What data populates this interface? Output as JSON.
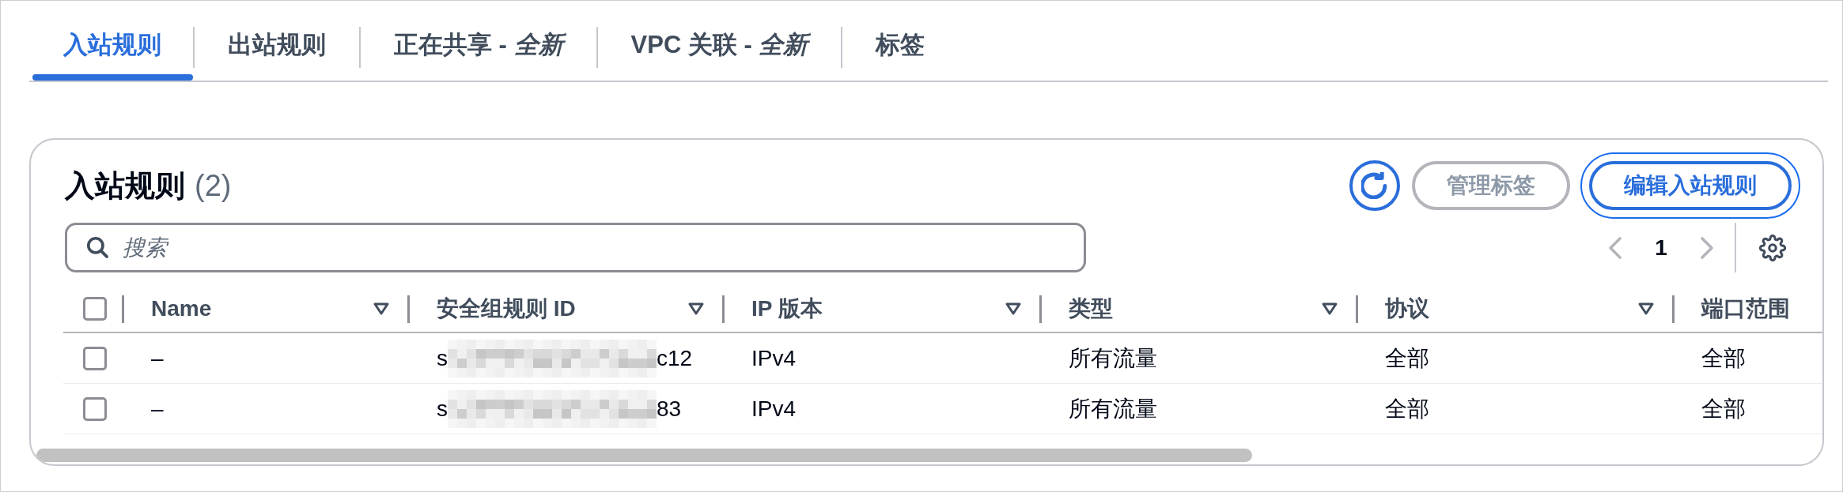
{
  "tabs": [
    {
      "label": "入站规则",
      "selected": true
    },
    {
      "label": "出站规则",
      "selected": false
    },
    {
      "label": "正在共享 - *全新*",
      "selected": false
    },
    {
      "label": "VPC 关联 - *全新*",
      "selected": false
    },
    {
      "label": "标签",
      "selected": false
    }
  ],
  "panel": {
    "title": "入站规则",
    "count": "(2)",
    "actions": [
      {
        "kind": "refresh",
        "disabled": false,
        "focused": false
      },
      {
        "kind": "text",
        "label": "管理标签",
        "disabled": true,
        "focused": false
      },
      {
        "kind": "text",
        "label": "编辑入站规则",
        "disabled": false,
        "focused": true
      }
    ],
    "search": {
      "placeholder": "搜索"
    },
    "pagination": {
      "previous_disabled": true,
      "pages": [
        {
          "label": "1",
          "selected": true
        }
      ],
      "next_disabled": true
    },
    "table": {
      "select_all_checked": false,
      "columns": [
        {
          "label": "Name",
          "sortable": true
        },
        {
          "label": "安全组规则 ID",
          "sortable": true
        },
        {
          "label": "IP 版本",
          "sortable": true
        },
        {
          "label": "类型",
          "sortable": true
        },
        {
          "label": "协议",
          "sortable": true
        },
        {
          "label": "端口范围"
        }
      ],
      "rows": [
        {
          "checked": false,
          "name": "–",
          "rule_id": {
            "start": "s",
            "redacted": true,
            "end": "c12"
          },
          "ip_version": "IPv4",
          "type": "所有流量",
          "protocol": "全部",
          "port_range": "全部"
        },
        {
          "checked": false,
          "name": "–",
          "rule_id": {
            "start": "s",
            "redacted": true,
            "end": "83"
          },
          "ip_version": "IPv4",
          "type": "所有流量",
          "protocol": "全部",
          "port_range": "全部"
        }
      ]
    }
  }
}
